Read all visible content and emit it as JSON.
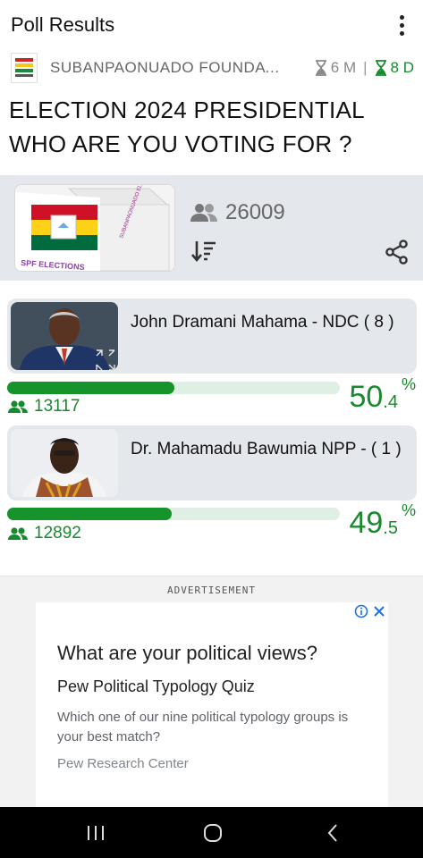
{
  "header": {
    "title": "Poll Results",
    "more_icon": "more-vertical-icon"
  },
  "org": {
    "name": "SUBANPAONUADO FOUNDATI...",
    "elapsed": "6 M",
    "separator": "|",
    "remaining": "8 D",
    "elapsed_icon": "hourglass-icon",
    "remaining_icon": "hourglass-icon"
  },
  "poll": {
    "question": "ELECTION 2024 PRESIDENTIAL WHO ARE YOU VOTING FOR ?",
    "total_votes": "26009",
    "image_caption": "SPF ELECTIONS",
    "image_side_text": "SUBANPAONUADO ELECTIONS"
  },
  "options": [
    {
      "label": "John Dramani Mahama - NDC ( 8 )",
      "votes": "13117",
      "percent_int": "50",
      "percent_dec": ".4",
      "percent_symbol": "%",
      "share": 0.504
    },
    {
      "label": "Dr. Mahamadu Bawumia NPP - ( 1 )",
      "votes": "12892",
      "percent_int": "49",
      "percent_dec": ".5",
      "percent_symbol": "%",
      "share": 0.495
    }
  ],
  "ad": {
    "label": "ADVERTISEMENT",
    "title": "What are your political views?",
    "subtitle": "Pew Political Typology Quiz",
    "description": "Which one of our nine political typology groups is your best match?",
    "source": "Pew Research Center"
  },
  "colors": {
    "accent_green": "#17932c",
    "band_gray": "#e4e7ec",
    "track_green": "#e0efe4"
  }
}
